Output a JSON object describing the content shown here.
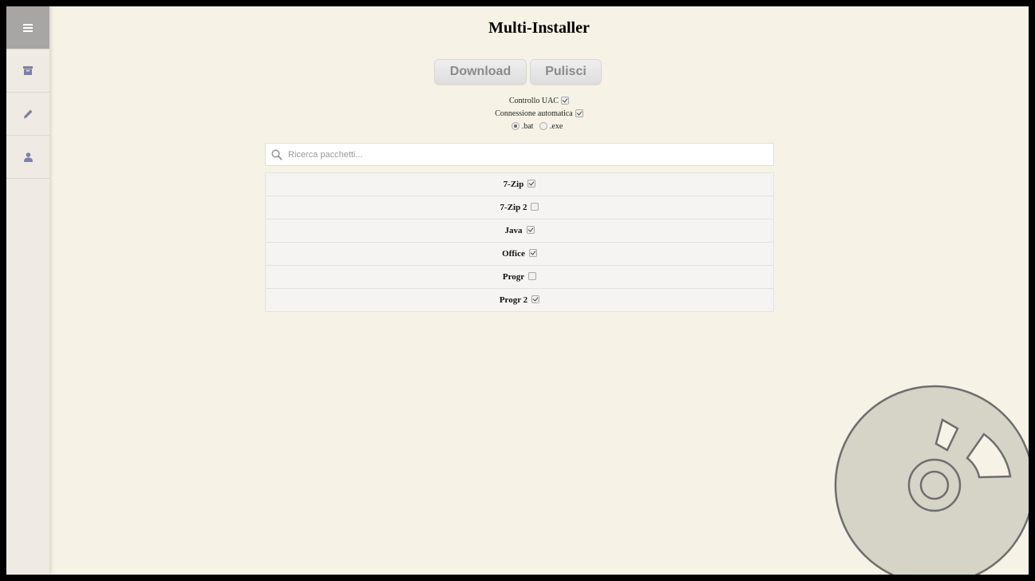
{
  "app": {
    "title": "Multi-Installer"
  },
  "sidebar": {
    "items": [
      {
        "name": "menu",
        "icon": "menu-icon",
        "active": true
      },
      {
        "name": "archive",
        "icon": "archive-icon",
        "active": false
      },
      {
        "name": "edit",
        "icon": "pencil-icon",
        "active": false
      },
      {
        "name": "user",
        "icon": "user-icon",
        "active": false
      }
    ],
    "icon_color": "#7f7fa8"
  },
  "toolbar": {
    "download_label": "Download",
    "clean_label": "Pulisci"
  },
  "options": {
    "uac_label": "Controllo UAC",
    "uac_checked": true,
    "autoconnect_label": "Connessione automatica",
    "autoconnect_checked": true,
    "format_options": [
      {
        "label": ".bat",
        "selected": true
      },
      {
        "label": ".exe",
        "selected": false
      }
    ]
  },
  "search": {
    "placeholder": "Ricerca pacchetti...",
    "value": ""
  },
  "packages": [
    {
      "label": "7-Zip",
      "checked": true
    },
    {
      "label": "7-Zip 2",
      "checked": false
    },
    {
      "label": "Java",
      "checked": true
    },
    {
      "label": "Office",
      "checked": true
    },
    {
      "label": "Progr",
      "checked": false
    },
    {
      "label": "Progr 2",
      "checked": true
    }
  ],
  "decoration": {
    "icon": "disc-icon",
    "color": "#d6d3c7",
    "stroke": "#6e6e6e"
  }
}
